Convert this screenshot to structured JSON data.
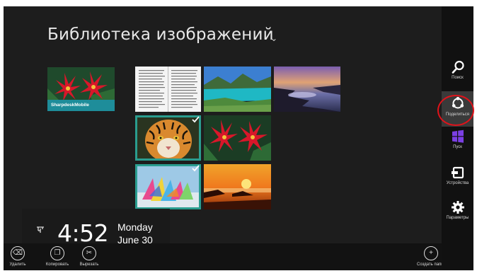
{
  "window": {
    "title": "Библиотека изображений",
    "chevron": "⌄"
  },
  "folder": {
    "label": "SharpdeskMobile"
  },
  "tiles": [
    {
      "name": "document-page",
      "selected": false
    },
    {
      "name": "lake-landscape",
      "selected": false
    },
    {
      "name": "rocky-shore-sunset",
      "selected": false
    },
    {
      "name": "tiger",
      "selected": true
    },
    {
      "name": "red-flowers",
      "selected": false
    },
    {
      "name": "colorful-sails",
      "selected": true
    },
    {
      "name": "orange-sunset",
      "selected": false
    }
  ],
  "charms": [
    {
      "label": "Поиск",
      "icon": "search-icon"
    },
    {
      "label": "Поделиться",
      "icon": "share-icon",
      "active": true
    },
    {
      "label": "Пуск",
      "icon": "windows-start-icon"
    },
    {
      "label": "Устройства",
      "icon": "devices-icon"
    },
    {
      "label": "Параметры",
      "icon": "gear-icon"
    }
  ],
  "clock": {
    "time": "4:52",
    "day": "Monday",
    "date": "June 30"
  },
  "appbar": {
    "buttons": [
      {
        "label": "Удалить",
        "icon": "delete-icon"
      },
      {
        "label": "Копировать",
        "icon": "copy-icon"
      },
      {
        "label": "Вырезать",
        "icon": "cut-icon"
      }
    ],
    "right_button": {
      "label": "Создать папку",
      "icon": "new-folder-icon"
    }
  },
  "colors": {
    "background": "#1d1d1d",
    "selection": "#2a9d8f",
    "folder_label": "#1e8d9a",
    "highlight_ring": "#e0121a"
  }
}
